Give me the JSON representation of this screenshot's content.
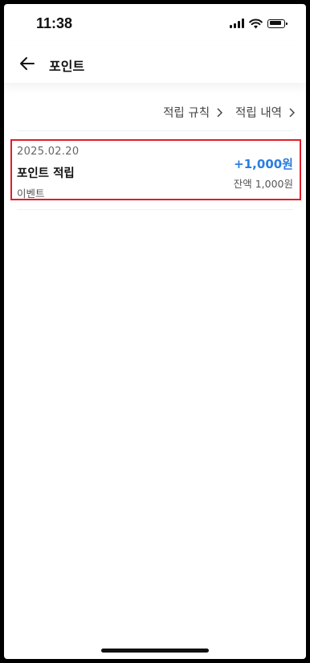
{
  "status_bar": {
    "time": "11:38"
  },
  "nav": {
    "title": "포인트"
  },
  "links": {
    "rules_label": "적립 규칙",
    "history_label": "적립 내역"
  },
  "history": {
    "items": [
      {
        "date": "2025.02.20",
        "title": "포인트 적립",
        "category": "이벤트",
        "amount": "+1,000원",
        "balance": "잔액 1,000원"
      }
    ]
  },
  "colors": {
    "amount": "#2a7de1",
    "highlight_border": "#e01e2a",
    "text_primary": "#111111"
  }
}
